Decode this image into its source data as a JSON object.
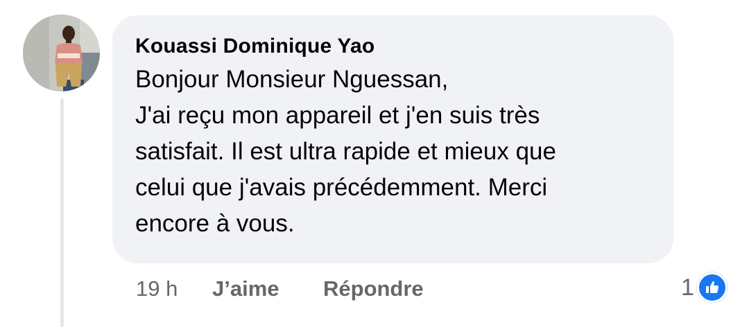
{
  "comment": {
    "author": "Kouassi Dominique Yao",
    "text_lines": [
      "Bonjour Monsieur Nguessan,",
      "J'ai reçu mon appareil et j'en suis très",
      "satisfait. Il est ultra rapide et mieux que",
      "celui que j'avais précédemment. Merci",
      "encore à vous."
    ],
    "avatar_icon": "profile-photo"
  },
  "actions": {
    "timestamp": "19 h",
    "like_label": "J’aime",
    "reply_label": "Répondre"
  },
  "reactions": {
    "count": "1",
    "icon": "like-thumb-icon",
    "color": "#1877f2"
  },
  "colors": {
    "bubble": "#f0f2f5",
    "text": "#050505",
    "secondary_text": "#65676b",
    "thread_line": "#e4e6eb"
  }
}
